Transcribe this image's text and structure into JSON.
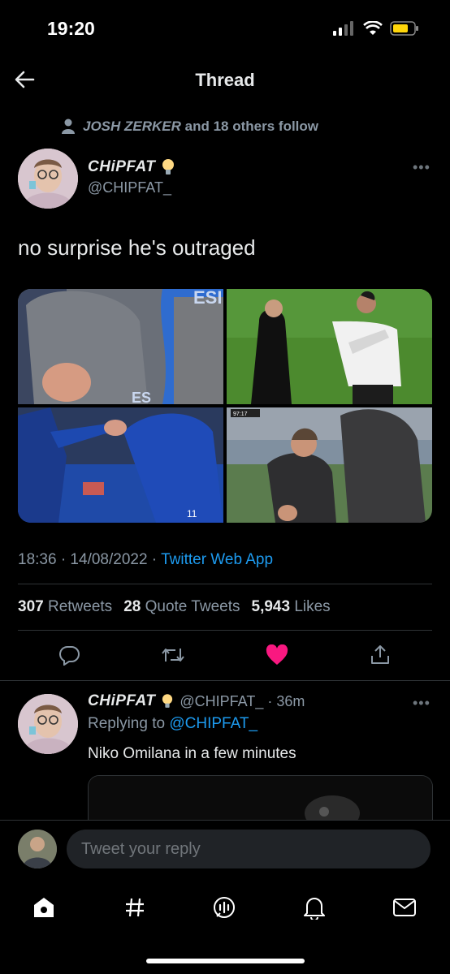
{
  "status_bar": {
    "time": "19:20"
  },
  "header": {
    "title": "Thread"
  },
  "social_context": {
    "bold_name": "JOSH ZERKER",
    "rest": "and 18 others follow"
  },
  "tweet": {
    "display_name": "CHiPFAT",
    "handle": "@CHIPFAT_",
    "text": "no surprise he's outraged",
    "time": "18:36 · 14/08/2022 · ",
    "source": "Twitter Web App",
    "stats": {
      "retweets_count": "307",
      "retweets_label": "Retweets",
      "quotes_count": "28",
      "quotes_label": "Quote Tweets",
      "likes_count": "5,943",
      "likes_label": "Likes"
    },
    "media_overlay_texts": [
      "ESI",
      "ES",
      "97:17",
      "11"
    ]
  },
  "reply": {
    "display_name": "CHiPFAT",
    "handle_time": "@CHIPFAT_ · 36m",
    "replying_label": "Replying to ",
    "replying_handle": "@CHIPFAT_",
    "text": "Niko Omilana in a few minutes"
  },
  "composer": {
    "placeholder": "Tweet your reply"
  },
  "colors": {
    "accent": "#1d9bf0",
    "like": "#f91880",
    "background": "#000000"
  },
  "icons": [
    "back-arrow-icon",
    "person-icon",
    "bulb-icon",
    "more-icon",
    "reply-icon",
    "retweet-icon",
    "heart-icon",
    "share-icon",
    "home-icon",
    "hashtag-icon",
    "spaces-icon",
    "bell-icon",
    "mail-icon"
  ]
}
